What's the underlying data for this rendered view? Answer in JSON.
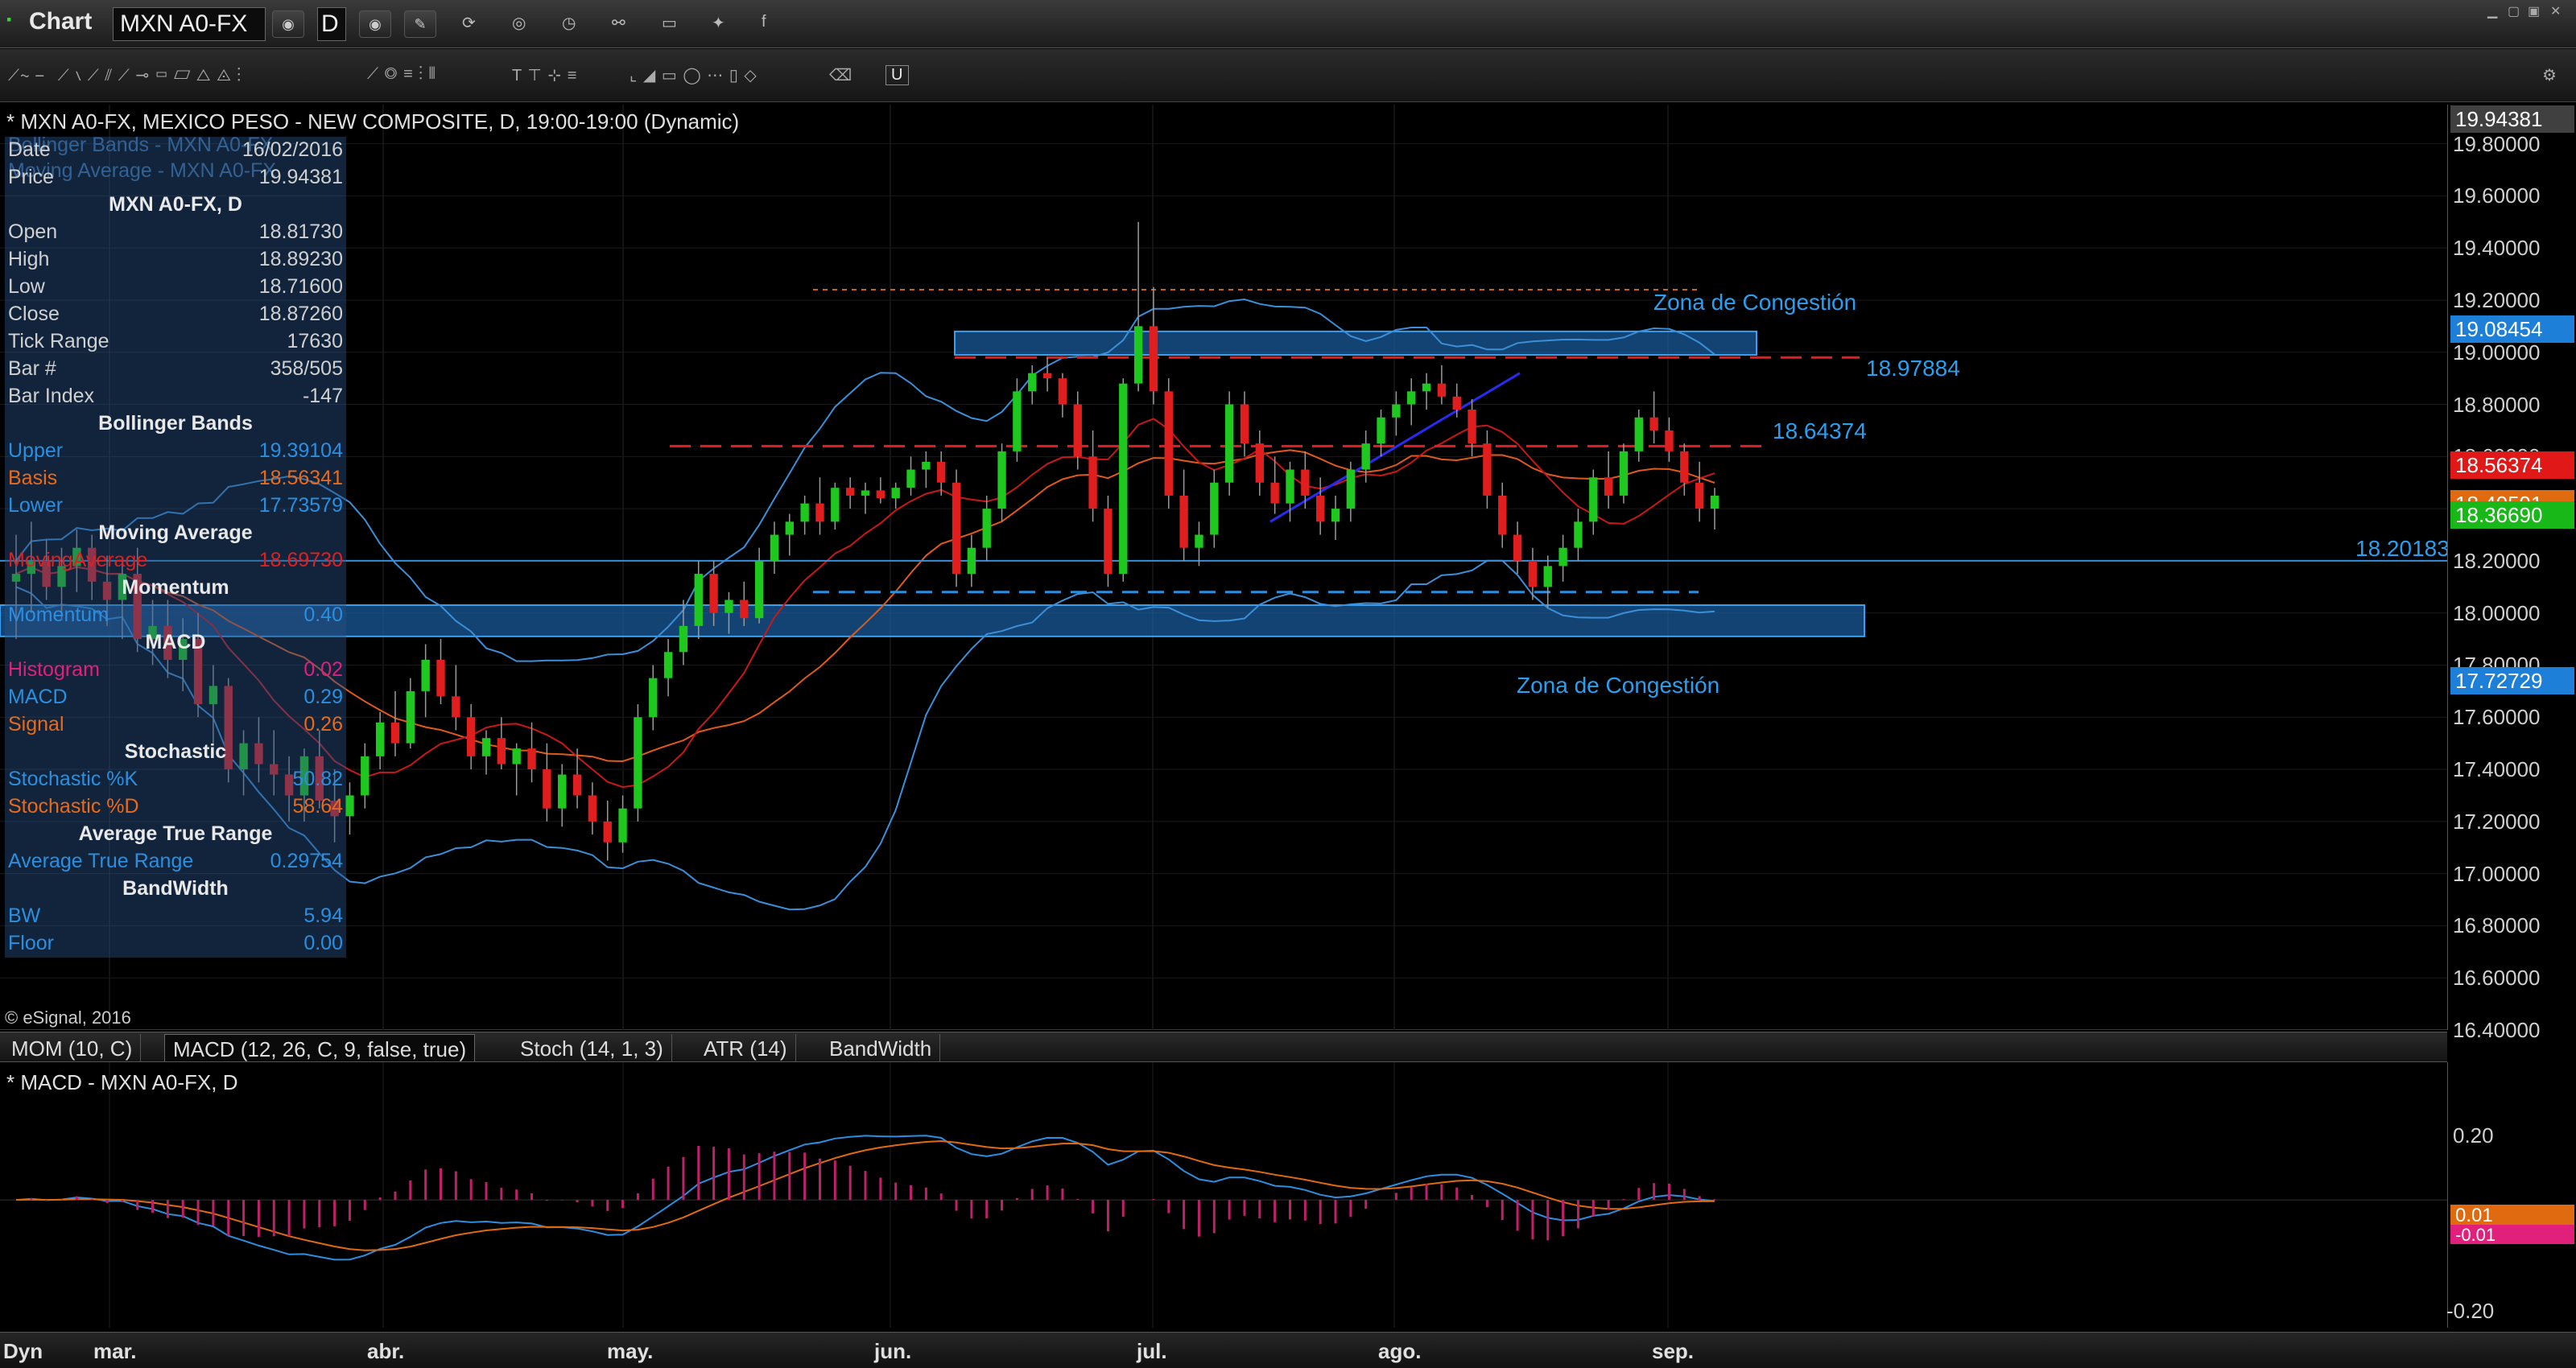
{
  "window": {
    "title": "Chart",
    "symbol": "MXN A0-FX",
    "interval": "D"
  },
  "header": {
    "title": "* MXN A0-FX, MEXICO PESO - NEW COMPOSITE, D, 19:00-19:00 (Dynamic)",
    "overlay_1": "Bollinger Bands - MXN A0-FX",
    "overlay_2": "Moving Average - MXN A0-FX"
  },
  "data_window": {
    "date_label": "Date",
    "date_value": "16/02/2016",
    "price_label": "Price",
    "price_value": "19.94381",
    "symbol_heading": "MXN A0-FX, D",
    "open_label": "Open",
    "open_value": "18.81730",
    "high_label": "High",
    "high_value": "18.89230",
    "low_label": "Low",
    "low_value": "18.71600",
    "close_label": "Close",
    "close_value": "18.87260",
    "tickrange_label": "Tick Range",
    "tickrange_value": "17630",
    "barnum_label": "Bar #",
    "barnum_value": "358/505",
    "barindex_label": "Bar Index",
    "barindex_value": "-147",
    "bb_heading": "Bollinger Bands",
    "upper_label": "Upper",
    "upper_value": "19.39104",
    "basis_label": "Basis",
    "basis_value": "18.56341",
    "lower_label": "Lower",
    "lower_value": "17.73579",
    "ma_heading": "Moving Average",
    "ma_label": "MovingAverage",
    "ma_value": "18.69730",
    "mom_heading": "Momentum",
    "mom_label": "Momentum",
    "mom_value": "0.40",
    "macd_heading": "MACD",
    "hist_label": "Histogram",
    "hist_value": "0.02",
    "macd_label": "MACD",
    "macd_value": "0.29",
    "signal_label": "Signal",
    "signal_value": "0.26",
    "stoch_heading": "Stochastic",
    "stochk_label": "Stochastic %K",
    "stochk_value": "50.82",
    "stochd_label": "Stochastic %D",
    "stochd_value": "58.64",
    "atr_heading": "Average True Range",
    "atr_label": "Average True Range",
    "atr_value": "0.29754",
    "bw_heading": "BandWidth",
    "bw_label": "BW",
    "bw_value": "5.94",
    "floor_label": "Floor",
    "floor_value": "0.00"
  },
  "annotations": {
    "zona_top": "Zona de Congestión",
    "zona_bottom": "Zona de Congestión",
    "level_high": "18.97884",
    "level_mid": "18.64374",
    "level_low": "18.20183"
  },
  "copyright": "© eSignal, 2016",
  "price_scale": {
    "labels": [
      "19.80000",
      "19.60000",
      "19.40000",
      "19.20000",
      "19.00000",
      "18.80000",
      "18.60000",
      "18.40000",
      "18.20000",
      "18.00000",
      "17.80000",
      "17.60000",
      "17.40000",
      "17.20000",
      "17.00000",
      "16.80000",
      "16.60000",
      "16.40000"
    ],
    "tag_top": "19.94381",
    "tag_upper": "19.08454",
    "tag_basis": "18.56374",
    "tag_ma": "18.40591",
    "tag_last": "18.36690",
    "tag_lower": "17.72729"
  },
  "tabs": [
    "MOM (10, C)",
    "MACD (12, 26, C, 9, false, true)",
    "Stoch (14, 1, 3)",
    "ATR (14)",
    "BandWidth"
  ],
  "macd_pane": {
    "header": "* MACD - MXN A0-FX, D",
    "labels": [
      "0.20",
      "-0.20"
    ],
    "tag_1": "0.01",
    "tag_2": "-0.01"
  },
  "time_axis": {
    "dyn": "Dyn",
    "months": [
      "mar.",
      "abr.",
      "may.",
      "jun.",
      "jul.",
      "ago.",
      "sep."
    ]
  },
  "colors": {
    "bull": "#1ec81e",
    "bear": "#e01e1e",
    "bb": "#3a8fd8",
    "ma": "#e05a1a",
    "zone_fill": "#1a5a99",
    "level_red": "#e02020",
    "level_blue": "#2a8fe0"
  },
  "chart_data": {
    "type": "candlestick",
    "title": "* MXN A0-FX, MEXICO PESO - NEW COMPOSITE, D, 19:00-19:00 (Dynamic)",
    "xlabel": "",
    "ylabel": "",
    "ylim": [
      16.4,
      19.95
    ],
    "x_ticks": [
      "mar.",
      "abr.",
      "may.",
      "jun.",
      "jul.",
      "ago.",
      "sep."
    ],
    "candles": [
      [
        18.12,
        18.3,
        17.9,
        18.15
      ],
      [
        18.15,
        18.35,
        18.0,
        18.2
      ],
      [
        18.2,
        18.28,
        18.05,
        18.1
      ],
      [
        18.1,
        18.25,
        17.98,
        18.18
      ],
      [
        18.18,
        18.32,
        18.08,
        18.25
      ],
      [
        18.25,
        18.3,
        18.05,
        18.12
      ],
      [
        18.12,
        18.22,
        17.95,
        18.05
      ],
      [
        18.05,
        18.2,
        17.9,
        18.15
      ],
      [
        18.15,
        18.25,
        17.85,
        17.9
      ],
      [
        17.9,
        18.05,
        17.8,
        17.95
      ],
      [
        17.95,
        18.05,
        17.75,
        17.82
      ],
      [
        17.82,
        17.98,
        17.7,
        17.9
      ],
      [
        17.9,
        18.0,
        17.6,
        17.65
      ],
      [
        17.65,
        17.8,
        17.5,
        17.72
      ],
      [
        17.72,
        17.75,
        17.35,
        17.4
      ],
      [
        17.4,
        17.55,
        17.3,
        17.5
      ],
      [
        17.5,
        17.6,
        17.35,
        17.42
      ],
      [
        17.42,
        17.55,
        17.3,
        17.38
      ],
      [
        17.38,
        17.45,
        17.2,
        17.3
      ],
      [
        17.3,
        17.48,
        17.2,
        17.45
      ],
      [
        17.45,
        17.55,
        17.25,
        17.28
      ],
      [
        17.28,
        17.4,
        17.12,
        17.22
      ],
      [
        17.22,
        17.35,
        17.15,
        17.3
      ],
      [
        17.3,
        17.5,
        17.25,
        17.45
      ],
      [
        17.45,
        17.62,
        17.4,
        17.58
      ],
      [
        17.58,
        17.7,
        17.45,
        17.5
      ],
      [
        17.5,
        17.75,
        17.48,
        17.7
      ],
      [
        17.7,
        17.88,
        17.6,
        17.82
      ],
      [
        17.82,
        17.9,
        17.65,
        17.68
      ],
      [
        17.68,
        17.8,
        17.55,
        17.6
      ],
      [
        17.6,
        17.65,
        17.4,
        17.45
      ],
      [
        17.45,
        17.55,
        17.38,
        17.52
      ],
      [
        17.52,
        17.6,
        17.4,
        17.42
      ],
      [
        17.42,
        17.5,
        17.3,
        17.48
      ],
      [
        17.48,
        17.58,
        17.35,
        17.4
      ],
      [
        17.4,
        17.5,
        17.2,
        17.25
      ],
      [
        17.25,
        17.42,
        17.18,
        17.38
      ],
      [
        17.38,
        17.48,
        17.25,
        17.3
      ],
      [
        17.3,
        17.35,
        17.15,
        17.2
      ],
      [
        17.2,
        17.28,
        17.05,
        17.12
      ],
      [
        17.12,
        17.3,
        17.08,
        17.25
      ],
      [
        17.25,
        17.65,
        17.2,
        17.6
      ],
      [
        17.6,
        17.8,
        17.55,
        17.75
      ],
      [
        17.75,
        17.9,
        17.68,
        17.85
      ],
      [
        17.85,
        18.05,
        17.8,
        17.95
      ],
      [
        17.95,
        18.2,
        17.9,
        18.15
      ],
      [
        18.15,
        18.2,
        17.95,
        18.0
      ],
      [
        18.0,
        18.08,
        17.92,
        18.05
      ],
      [
        18.05,
        18.12,
        17.95,
        17.98
      ],
      [
        17.98,
        18.25,
        17.96,
        18.2
      ],
      [
        18.2,
        18.35,
        18.15,
        18.3
      ],
      [
        18.3,
        18.38,
        18.22,
        18.35
      ],
      [
        18.35,
        18.45,
        18.3,
        18.42
      ],
      [
        18.42,
        18.52,
        18.3,
        18.35
      ],
      [
        18.35,
        18.5,
        18.32,
        18.48
      ],
      [
        18.48,
        18.52,
        18.4,
        18.45
      ],
      [
        18.45,
        18.5,
        18.38,
        18.47
      ],
      [
        18.47,
        18.52,
        18.42,
        18.44
      ],
      [
        18.44,
        18.5,
        18.4,
        18.48
      ],
      [
        18.48,
        18.6,
        18.45,
        18.55
      ],
      [
        18.55,
        18.62,
        18.48,
        18.58
      ],
      [
        18.58,
        18.62,
        18.45,
        18.5
      ],
      [
        18.5,
        18.55,
        18.1,
        18.15
      ],
      [
        18.15,
        18.3,
        18.1,
        18.25
      ],
      [
        18.25,
        18.45,
        18.2,
        18.4
      ],
      [
        18.4,
        18.65,
        18.35,
        18.62
      ],
      [
        18.62,
        18.9,
        18.58,
        18.85
      ],
      [
        18.85,
        18.95,
        18.8,
        18.92
      ],
      [
        18.92,
        18.98,
        18.85,
        18.9
      ],
      [
        18.9,
        18.92,
        18.75,
        18.8
      ],
      [
        18.8,
        18.85,
        18.55,
        18.6
      ],
      [
        18.6,
        18.7,
        18.35,
        18.4
      ],
      [
        18.4,
        18.45,
        18.1,
        18.15
      ],
      [
        18.15,
        18.9,
        18.12,
        18.88
      ],
      [
        18.88,
        19.5,
        18.85,
        19.1
      ],
      [
        19.1,
        19.25,
        18.8,
        18.85
      ],
      [
        18.85,
        18.9,
        18.4,
        18.45
      ],
      [
        18.45,
        18.55,
        18.2,
        18.25
      ],
      [
        18.25,
        18.35,
        18.18,
        18.3
      ],
      [
        18.3,
        18.55,
        18.25,
        18.5
      ],
      [
        18.5,
        18.85,
        18.45,
        18.8
      ],
      [
        18.8,
        18.85,
        18.6,
        18.65
      ],
      [
        18.65,
        18.7,
        18.45,
        18.5
      ],
      [
        18.5,
        18.6,
        18.38,
        18.42
      ],
      [
        18.42,
        18.58,
        18.35,
        18.55
      ],
      [
        18.55,
        18.62,
        18.4,
        18.45
      ],
      [
        18.45,
        18.52,
        18.3,
        18.35
      ],
      [
        18.35,
        18.45,
        18.28,
        18.4
      ],
      [
        18.4,
        18.58,
        18.35,
        18.55
      ],
      [
        18.55,
        18.7,
        18.5,
        18.65
      ],
      [
        18.65,
        18.78,
        18.6,
        18.75
      ],
      [
        18.75,
        18.85,
        18.68,
        18.8
      ],
      [
        18.8,
        18.9,
        18.72,
        18.85
      ],
      [
        18.85,
        18.92,
        18.78,
        18.88
      ],
      [
        18.88,
        18.95,
        18.8,
        18.83
      ],
      [
        18.83,
        18.88,
        18.75,
        18.78
      ],
      [
        18.78,
        18.82,
        18.6,
        18.65
      ],
      [
        18.65,
        18.7,
        18.4,
        18.45
      ],
      [
        18.45,
        18.5,
        18.25,
        18.3
      ],
      [
        18.3,
        18.35,
        18.15,
        18.2
      ],
      [
        18.2,
        18.25,
        18.05,
        18.1
      ],
      [
        18.1,
        18.22,
        18.02,
        18.18
      ],
      [
        18.18,
        18.3,
        18.12,
        18.25
      ],
      [
        18.25,
        18.4,
        18.2,
        18.35
      ],
      [
        18.35,
        18.55,
        18.3,
        18.52
      ],
      [
        18.52,
        18.62,
        18.4,
        18.45
      ],
      [
        18.45,
        18.65,
        18.42,
        18.62
      ],
      [
        18.62,
        18.78,
        18.58,
        18.75
      ],
      [
        18.75,
        18.85,
        18.65,
        18.7
      ],
      [
        18.7,
        18.75,
        18.58,
        18.62
      ],
      [
        18.62,
        18.65,
        18.45,
        18.5
      ],
      [
        18.5,
        18.58,
        18.35,
        18.4
      ],
      [
        18.4,
        18.48,
        18.32,
        18.45
      ]
    ]
  }
}
